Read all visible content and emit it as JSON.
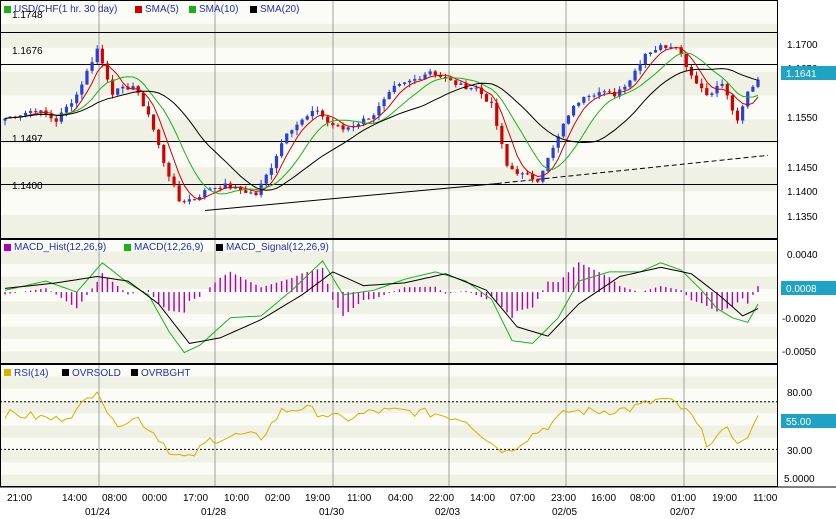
{
  "colors": {
    "background": "#ffffff",
    "band_light": "#fbfcf6",
    "band_dark": "#eef1e3",
    "frame": "#000000",
    "grid": "#a0a0a0",
    "candle_up": "#2b3fd6",
    "candle_down": "#d40000",
    "sma5": "#d40000",
    "sma10": "#19b319",
    "sma20": "#000000",
    "macd_hist": "#b000b0",
    "macd": "#19b319",
    "macd_signal": "#000000",
    "rsi": "#d7b000",
    "levels": "#000000",
    "tag_bg": "#1fa3c4"
  },
  "chart_data": [
    {
      "type": "candlestick",
      "panel": "price",
      "legend": [
        {
          "label": "USD/CHF(1 hr. 30 day)",
          "color": "#19b319",
          "icon": "square"
        },
        {
          "label": "SMA(5)",
          "color": "#d40000",
          "icon": "square"
        },
        {
          "label": "SMA(10)",
          "color": "#19b319",
          "icon": "square"
        },
        {
          "label": "SMA(20)",
          "color": "#000000",
          "icon": "square"
        }
      ],
      "y_ticks": [
        "1.1700",
        "1.1650",
        "1.1550",
        "1.1450",
        "1.1400",
        "1.1350"
      ],
      "ylim": [
        1.13,
        1.1795
      ],
      "current_value": "1.1641",
      "horizontal_levels": [
        {
          "label": "1.1748",
          "value": 1.1748
        },
        {
          "label": "1.1676",
          "value": 1.1676
        },
        {
          "label": "1.1497",
          "value": 1.1497
        },
        {
          "label": "1.1400",
          "value": 1.14
        }
      ],
      "trendline": {
        "style": "solid",
        "points": [
          [
            0,
            1.1338
          ],
          [
            96,
            1.14
          ]
        ]
      },
      "trendline_extension": {
        "style": "dashed",
        "points": [
          [
            96,
            1.14
          ],
          [
            147,
            1.1465
          ]
        ]
      },
      "n_bars": 148,
      "key_closes": [
        [
          0,
          1.155
        ],
        [
          6,
          1.157
        ],
        [
          10,
          1.1545
        ],
        [
          14,
          1.1605
        ],
        [
          18,
          1.171
        ],
        [
          21,
          1.161
        ],
        [
          25,
          1.1625
        ],
        [
          28,
          1.156
        ],
        [
          31,
          1.145
        ],
        [
          34,
          1.136
        ],
        [
          37,
          1.1365
        ],
        [
          40,
          1.139
        ],
        [
          43,
          1.1395
        ],
        [
          46,
          1.1385
        ],
        [
          49,
          1.1375
        ],
        [
          52,
          1.144
        ],
        [
          55,
          1.152
        ],
        [
          58,
          1.1545
        ],
        [
          61,
          1.157
        ],
        [
          63,
          1.154
        ],
        [
          66,
          1.1525
        ],
        [
          69,
          1.154
        ],
        [
          72,
          1.156
        ],
        [
          76,
          1.162
        ],
        [
          80,
          1.164
        ],
        [
          83,
          1.166
        ],
        [
          86,
          1.164
        ],
        [
          89,
          1.1625
        ],
        [
          92,
          1.162
        ],
        [
          95,
          1.158
        ],
        [
          98,
          1.144
        ],
        [
          101,
          1.142
        ],
        [
          104,
          1.141
        ],
        [
          107,
          1.148
        ],
        [
          110,
          1.156
        ],
        [
          113,
          1.1605
        ],
        [
          116,
          1.161
        ],
        [
          119,
          1.1605
        ],
        [
          122,
          1.164
        ],
        [
          125,
          1.17
        ],
        [
          128,
          1.1715
        ],
        [
          131,
          1.172
        ],
        [
          134,
          1.165
        ],
        [
          137,
          1.1605
        ],
        [
          140,
          1.163
        ],
        [
          143,
          1.154
        ],
        [
          145,
          1.161
        ],
        [
          147,
          1.1641
        ]
      ]
    },
    {
      "type": "line",
      "panel": "macd",
      "legend": [
        {
          "label": "MACD_Hist(12,26,9)",
          "color": "#b000b0",
          "icon": "square"
        },
        {
          "label": "MACD(12,26,9)",
          "color": "#19b319",
          "icon": "square"
        },
        {
          "label": "MACD_Signal(12,26,9)",
          "color": "#000000",
          "icon": "square"
        }
      ],
      "y_ticks": [
        "0.0040",
        "-0.0020",
        "-0.0050"
      ],
      "ylim": [
        -0.0065,
        0.0055
      ],
      "current_value": "0.0008",
      "macd_key": [
        [
          0,
          0.001
        ],
        [
          8,
          0.002
        ],
        [
          14,
          0.0008
        ],
        [
          19,
          0.004
        ],
        [
          24,
          0.0018
        ],
        [
          28,
          0.0005
        ],
        [
          32,
          -0.0035
        ],
        [
          35,
          -0.0058
        ],
        [
          38,
          -0.005
        ],
        [
          44,
          -0.002
        ],
        [
          50,
          -0.0018
        ],
        [
          56,
          0.001
        ],
        [
          62,
          0.0042
        ],
        [
          66,
          0.0005
        ],
        [
          72,
          0.001
        ],
        [
          78,
          0.0022
        ],
        [
          84,
          0.003
        ],
        [
          90,
          0.002
        ],
        [
          95,
          0.0
        ],
        [
          99,
          -0.0045
        ],
        [
          103,
          -0.0048
        ],
        [
          108,
          -0.002
        ],
        [
          112,
          0.002
        ],
        [
          118,
          0.003
        ],
        [
          124,
          0.003
        ],
        [
          128,
          0.004
        ],
        [
          132,
          0.0032
        ],
        [
          136,
          0.001
        ],
        [
          139,
          -0.001
        ],
        [
          142,
          -0.002
        ],
        [
          145,
          -0.0025
        ],
        [
          147,
          -0.0005
        ]
      ],
      "signal_key": [
        [
          0,
          0.0012
        ],
        [
          10,
          0.0018
        ],
        [
          18,
          0.0025
        ],
        [
          24,
          0.002
        ],
        [
          30,
          -0.0005
        ],
        [
          36,
          -0.0048
        ],
        [
          42,
          -0.0042
        ],
        [
          50,
          -0.0022
        ],
        [
          58,
          0.0005
        ],
        [
          64,
          0.003
        ],
        [
          70,
          0.0015
        ],
        [
          78,
          0.0018
        ],
        [
          86,
          0.0028
        ],
        [
          94,
          0.001
        ],
        [
          100,
          -0.003
        ],
        [
          106,
          -0.004
        ],
        [
          112,
          -0.0005
        ],
        [
          120,
          0.0025
        ],
        [
          128,
          0.0035
        ],
        [
          134,
          0.0028
        ],
        [
          140,
          0.0002
        ],
        [
          144,
          -0.0018
        ],
        [
          147,
          -0.001
        ]
      ]
    },
    {
      "type": "line",
      "panel": "rsi",
      "legend": [
        {
          "label": "RSI(14)",
          "color": "#d7b000",
          "icon": "square"
        },
        {
          "label": "OVRSOLD",
          "color": "#000000",
          "icon": "square"
        },
        {
          "label": "OVRBGHT",
          "color": "#000000",
          "icon": "square"
        }
      ],
      "y_ticks": [
        "80.00",
        "30.00",
        "5.0000"
      ],
      "ylim": [
        0,
        95
      ],
      "current_value": "55.00",
      "oversold_level": 30,
      "overbought_level": 70,
      "rsi_key": [
        [
          0,
          60
        ],
        [
          5,
          58
        ],
        [
          10,
          55
        ],
        [
          14,
          62
        ],
        [
          18,
          82
        ],
        [
          21,
          52
        ],
        [
          26,
          56
        ],
        [
          30,
          40
        ],
        [
          33,
          25
        ],
        [
          36,
          22
        ],
        [
          40,
          38
        ],
        [
          46,
          42
        ],
        [
          50,
          40
        ],
        [
          54,
          62
        ],
        [
          58,
          65
        ],
        [
          62,
          60
        ],
        [
          66,
          55
        ],
        [
          72,
          62
        ],
        [
          78,
          62
        ],
        [
          84,
          60
        ],
        [
          90,
          55
        ],
        [
          95,
          35
        ],
        [
          98,
          28
        ],
        [
          102,
          40
        ],
        [
          106,
          50
        ],
        [
          110,
          62
        ],
        [
          116,
          62
        ],
        [
          122,
          64
        ],
        [
          128,
          72
        ],
        [
          131,
          68
        ],
        [
          134,
          58
        ],
        [
          137,
          36
        ],
        [
          141,
          45
        ],
        [
          144,
          35
        ],
        [
          147,
          55
        ]
      ]
    }
  ],
  "x_axis": {
    "time_labels": [
      "21:00",
      "14:00",
      "08:00",
      "00:00",
      "17:00",
      "10:00",
      "02:00",
      "19:00",
      "11:00",
      "04:00",
      "22:00",
      "14:00",
      "07:00",
      "23:00",
      "16:00",
      "08:00",
      "01:00",
      "19:00",
      "11:00"
    ],
    "date_labels": [
      "01/24",
      "01/28",
      "01/30",
      "02/03",
      "02/05",
      "02/07"
    ]
  }
}
